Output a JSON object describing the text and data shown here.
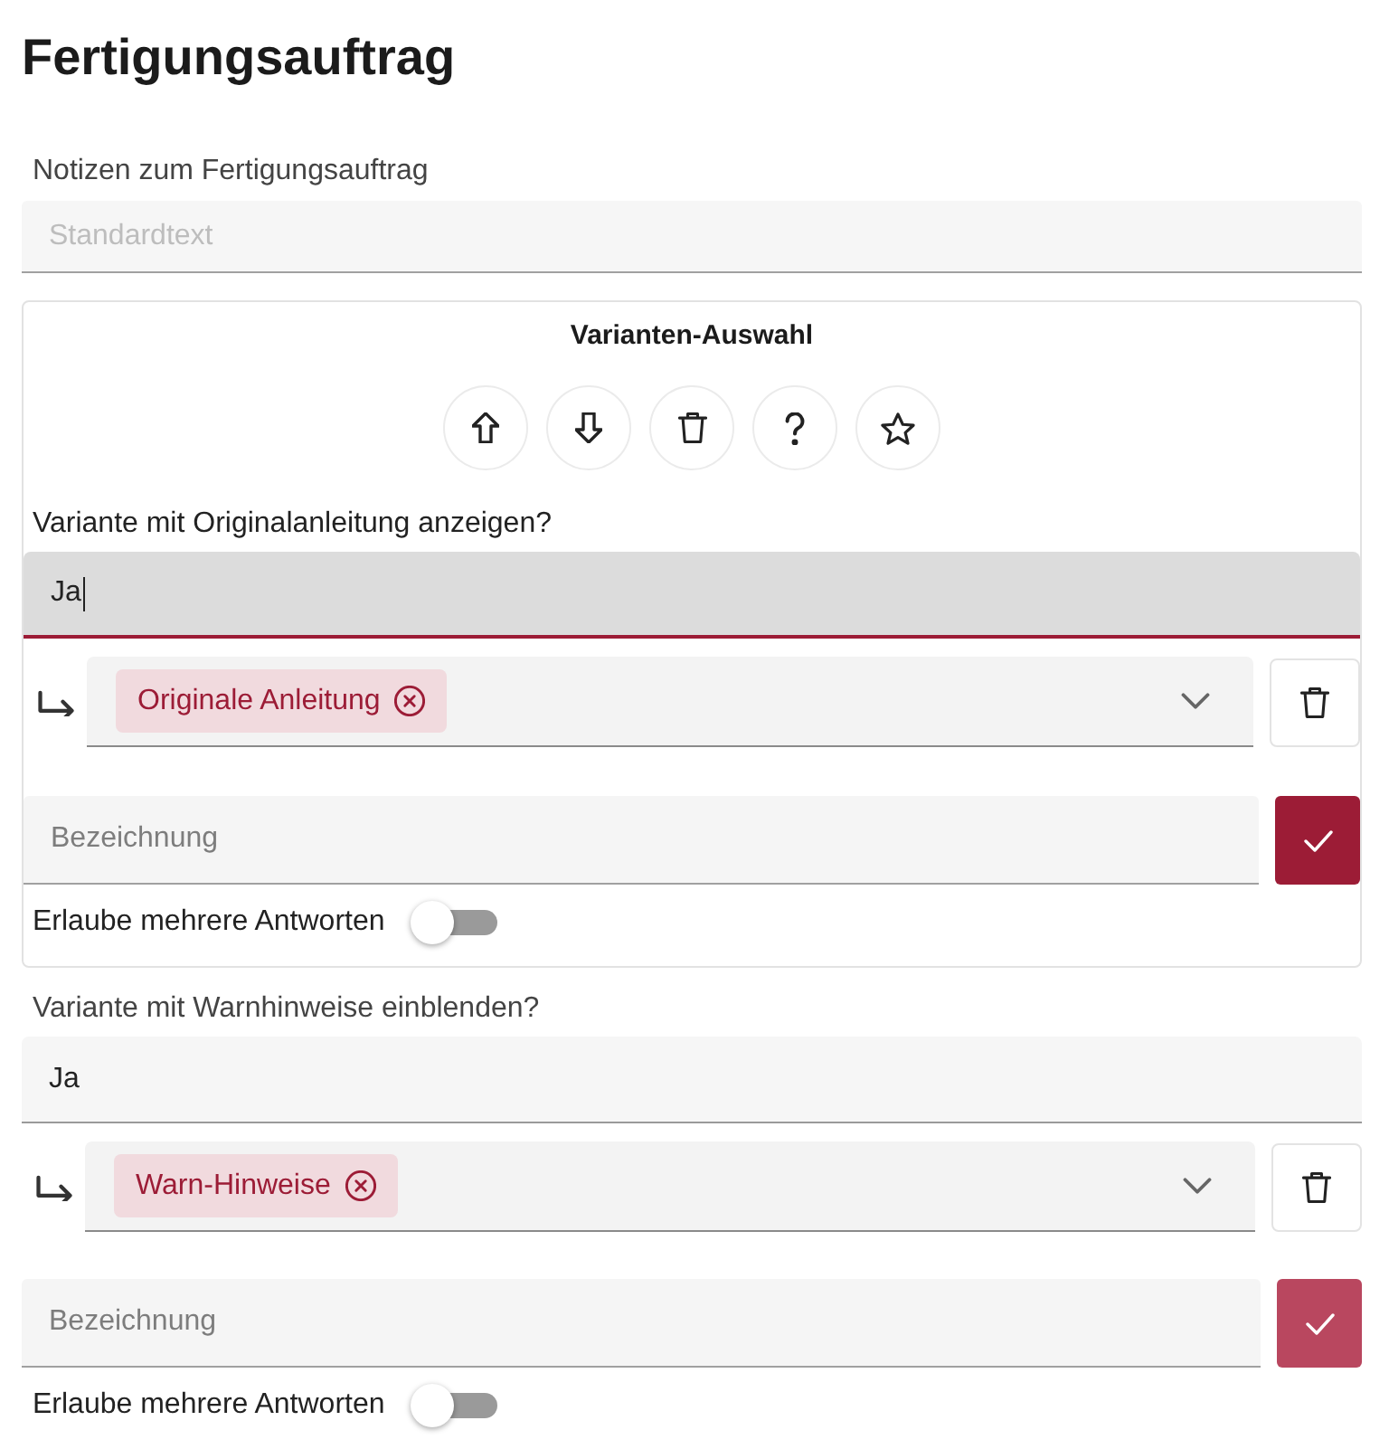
{
  "title": "Fertigungsauftrag",
  "notes": {
    "label": "Notizen zum Fertigungsauftrag",
    "placeholder": "Standardtext"
  },
  "variant_card": {
    "title": "Varianten-Auswahl",
    "questions": [
      {
        "label": "Variante mit Originalanleitung anzeigen?",
        "answer": {
          "value": "Ja",
          "focused": true
        },
        "options": [
          {
            "label": "Originale Anleitung"
          }
        ],
        "name_field": {
          "placeholder": "Bezeichnung",
          "confirm_disabled": false
        },
        "multiple_answers": {
          "label": "Erlaube mehrere Antworten",
          "on": false
        }
      }
    ]
  },
  "more_questions": [
    {
      "label": "Variante mit Warnhinweise einblenden?",
      "answer": {
        "value": "Ja",
        "focused": false
      },
      "options": [
        {
          "label": "Warn-Hinweise"
        }
      ],
      "name_field": {
        "placeholder": "Bezeichnung",
        "confirm_disabled": true
      },
      "multiple_answers": {
        "label": "Erlaube mehrere Antworten",
        "on": false
      }
    }
  ]
}
